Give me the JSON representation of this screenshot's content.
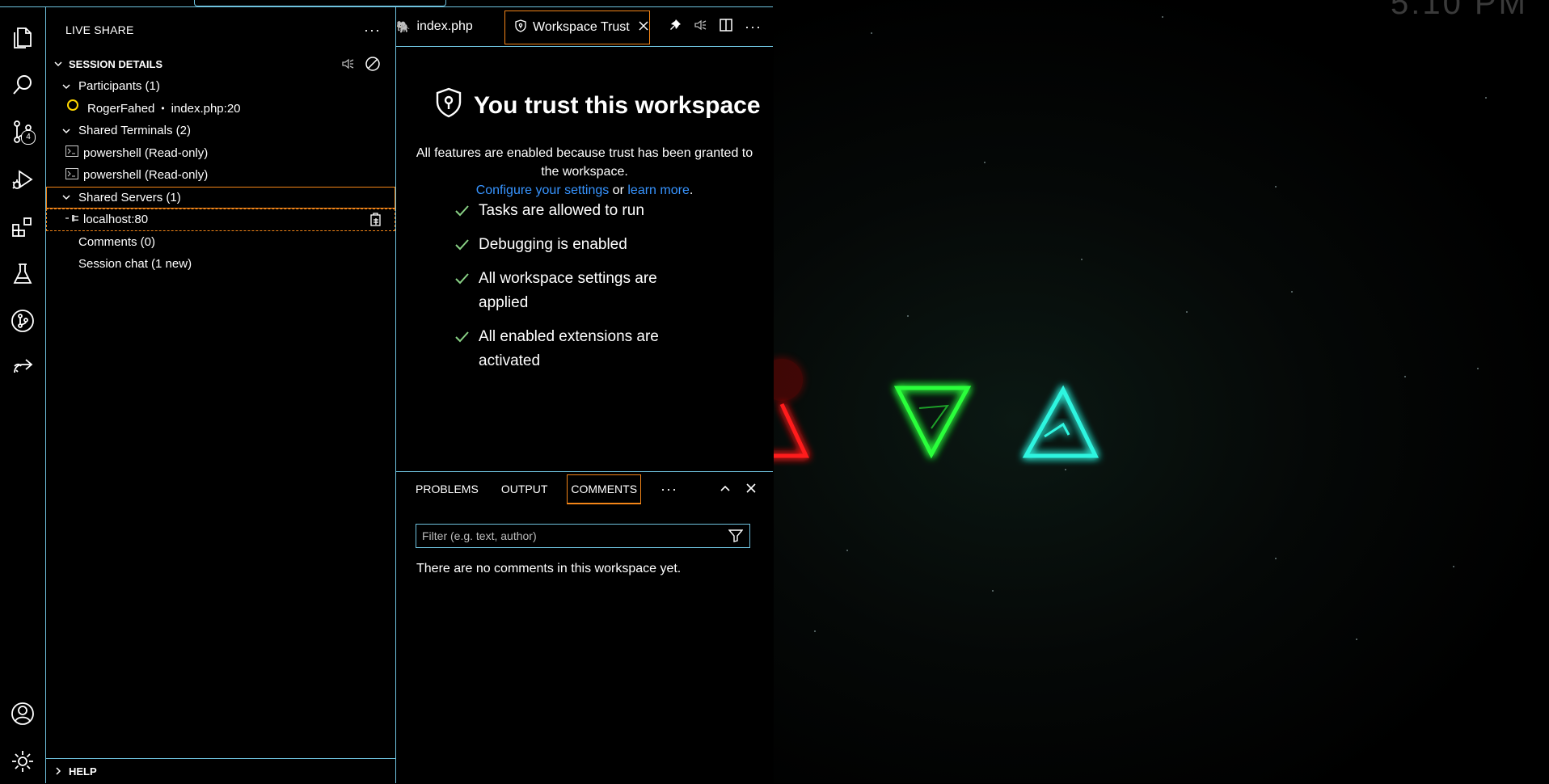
{
  "sidebar": {
    "title": "LIVE SHARE",
    "more": "···",
    "session_section": "SESSION DETAILS",
    "participants_label": "Participants (1)",
    "participant_name": "RogerFahed",
    "participant_location": "index.php:20",
    "terminals_label": "Shared Terminals (2)",
    "terminals": [
      "powershell (Read-only)",
      "powershell (Read-only)"
    ],
    "servers_label": "Shared Servers (1)",
    "server": "localhost:80",
    "comments_label": "Comments (0)",
    "chat_label": "Session chat (1 new)",
    "help_section": "HELP"
  },
  "activity": {
    "scm_badge": "4"
  },
  "editor": {
    "tabs": [
      {
        "label": "index.php",
        "active": false
      },
      {
        "label": "Workspace Trust",
        "active": true
      }
    ],
    "more": "···"
  },
  "trust": {
    "title": "You trust this workspace",
    "description": "All features are enabled because trust has been granted to the workspace.",
    "configure_link": "Configure your settings",
    "or_text": " or ",
    "learn_link": "learn more",
    "period": ".",
    "checks": [
      "Tasks are allowed to run",
      "Debugging is enabled",
      "All workspace settings are applied",
      "All enabled extensions are activated"
    ]
  },
  "panel": {
    "tabs": [
      "PROBLEMS",
      "OUTPUT",
      "COMMENTS"
    ],
    "active_tab": "COMMENTS",
    "more": "···",
    "filter_placeholder": "Filter (e.g. text, author)",
    "empty_message": "There are no comments in this workspace yet."
  },
  "desktop": {
    "clock": "5:10 PM"
  },
  "colors": {
    "border": "#6fc3df",
    "focus": "#f38518",
    "link": "#3794ff",
    "check": "#89d185",
    "participant_ring": "#ffd700",
    "red": "#ff1a1a",
    "green": "#2cff3a",
    "teal": "#2ff5e0"
  }
}
